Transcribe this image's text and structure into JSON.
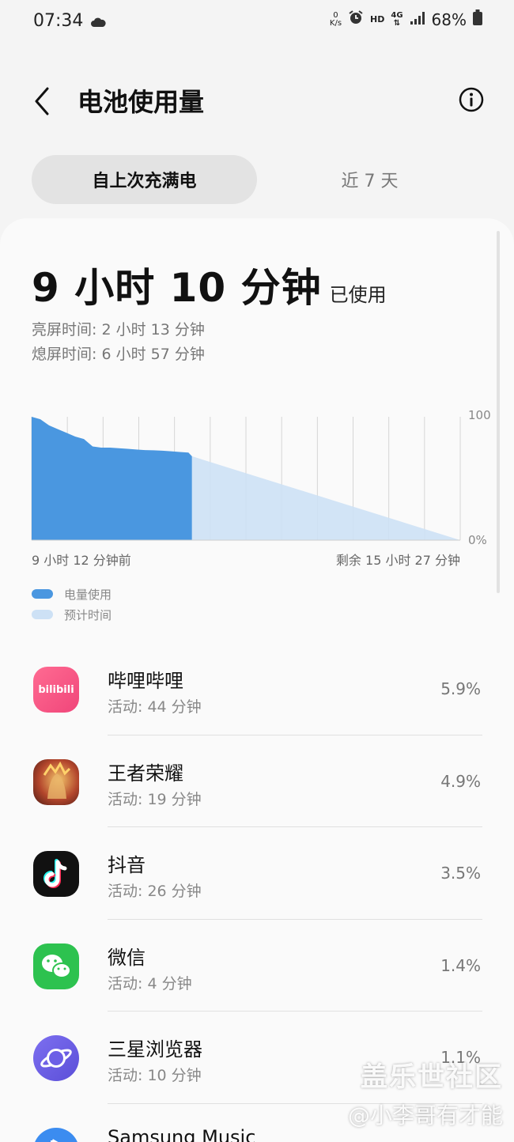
{
  "status_bar": {
    "time": "07:34",
    "net_speed_value": "0",
    "net_speed_unit": "K/s",
    "hd": "HD",
    "network": "4G",
    "battery": "68%"
  },
  "header": {
    "title": "电池使用量"
  },
  "tabs": [
    {
      "label": "自上次充满电",
      "active": true
    },
    {
      "label": "近 7 天",
      "active": false
    }
  ],
  "summary": {
    "used_value": "9 小时 10 分钟",
    "used_suffix": "已使用",
    "screen_on": "亮屏时间:  2 小时 13 分钟",
    "screen_off": "熄屏时间:   6 小时 57 分钟"
  },
  "chart_data": {
    "type": "area",
    "y_max_label": "100",
    "y_min_label": "0%",
    "x_start_label": "9 小时 12 分钟前",
    "x_end_label": "剩余 15 小时 27 分钟",
    "x_hours": [
      0,
      0.5,
      1,
      1.5,
      2,
      2.5,
      3,
      3.5,
      4,
      4.5,
      5,
      5.5,
      6,
      6.5,
      7,
      7.5,
      8,
      8.5,
      9,
      9.2
    ],
    "usage_percent": [
      100,
      98,
      93,
      90,
      87,
      84,
      82,
      76,
      75,
      75,
      74.5,
      74,
      73.5,
      73,
      72.8,
      72.5,
      72,
      71.5,
      71,
      68
    ],
    "projection": {
      "x_hours": [
        9.2,
        24.6
      ],
      "percent": [
        68,
        0
      ]
    },
    "grid": true,
    "colors": {
      "usage": "#4a97e0",
      "projection": "#cde1f5",
      "grid": "#d5d5d5"
    }
  },
  "legend": [
    {
      "label": "电量使用",
      "color": "#4a97e0"
    },
    {
      "label": "预计时间",
      "color": "#cde1f5"
    }
  ],
  "apps": [
    {
      "name": "哔哩哔哩",
      "activity": "活动: 44 分钟",
      "percent": "5.9%",
      "icon": "bilibili-icon",
      "icon_text": "bilibili"
    },
    {
      "name": "王者荣耀",
      "activity": "活动: 19 分钟",
      "percent": "4.9%",
      "icon": "honor-of-kings-icon"
    },
    {
      "name": "抖音",
      "activity": "活动: 26 分钟",
      "percent": "3.5%",
      "icon": "douyin-icon"
    },
    {
      "name": "微信",
      "activity": "活动: 4 分钟",
      "percent": "1.4%",
      "icon": "wechat-icon"
    },
    {
      "name": "三星浏览器",
      "activity": "活动: 10 分钟",
      "percent": "1.1%",
      "icon": "samsung-internet-icon"
    },
    {
      "name": "Samsung Music",
      "activity": "",
      "percent": "",
      "icon": "samsung-music-icon"
    }
  ],
  "watermark": {
    "line1": "盖乐世社区",
    "line2": "@小李哥有才能"
  }
}
